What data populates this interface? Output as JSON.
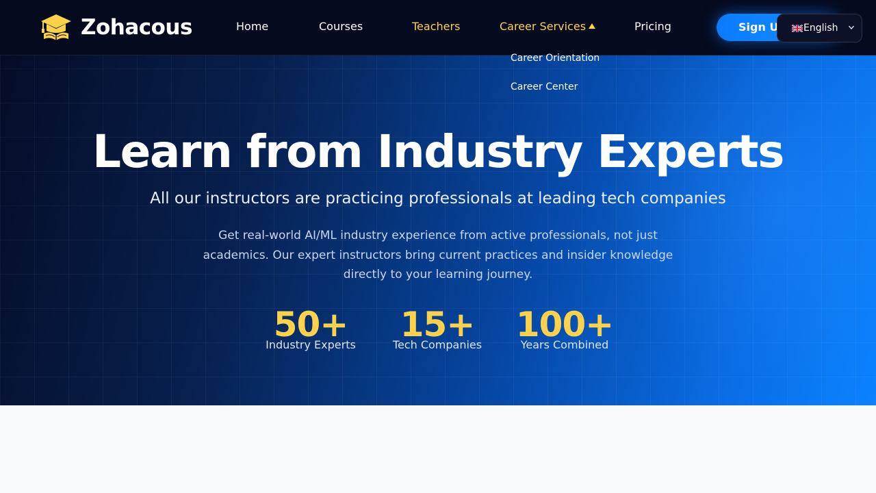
{
  "brand": {
    "name": "Zohacous",
    "logo_icon": "graduation-cap-book-icon",
    "logo_color": "#fcd24a"
  },
  "nav": {
    "items": [
      {
        "label": "Home",
        "active": false
      },
      {
        "label": "Courses",
        "active": false
      },
      {
        "label": "Teachers",
        "active": true
      },
      {
        "label": "Career Services",
        "active": true,
        "dropdown_open": true
      },
      {
        "label": "Pricing",
        "active": false
      }
    ],
    "dropdown": {
      "items": [
        "Career Orientation",
        "Career Center"
      ]
    },
    "signup_label": "Sign Up",
    "language": {
      "selected": "English",
      "flag_icon": "uk-flag-icon"
    }
  },
  "hero": {
    "title": "Learn from Industry Experts",
    "subtitle": "All our instructors are practicing professionals at leading tech companies",
    "description": "Get real-world AI/ML industry experience from active professionals, not just academics. Our expert instructors bring current practices and insider knowledge directly to your learning journey.",
    "stats": [
      {
        "value": "50+",
        "label": "Industry Experts"
      },
      {
        "value": "15+",
        "label": "Tech Companies"
      },
      {
        "value": "100+",
        "label": "Years Combined"
      }
    ]
  },
  "colors": {
    "accent": "#fcd24a",
    "primary": "#0b7bff",
    "nav_bg": "#050a1e",
    "page_bg": "#f8fafc"
  }
}
